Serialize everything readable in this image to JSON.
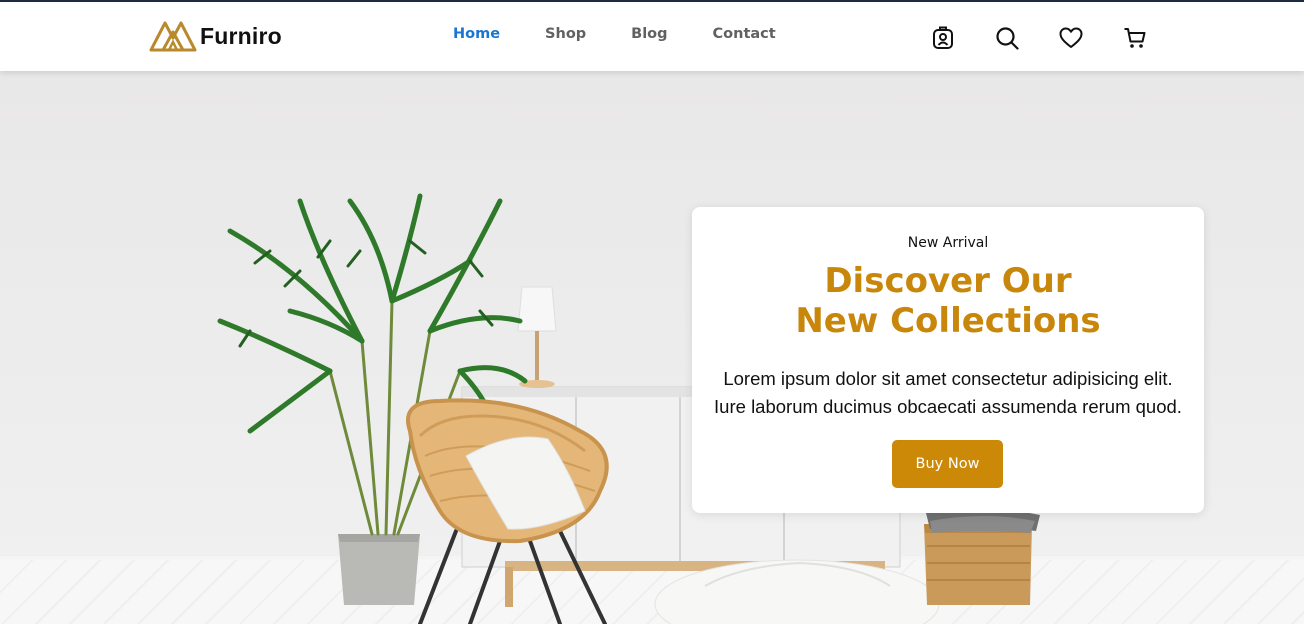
{
  "brand": {
    "name": "Furniro"
  },
  "nav": {
    "items": [
      {
        "label": "Home",
        "active": true
      },
      {
        "label": "Shop",
        "active": false
      },
      {
        "label": "Blog",
        "active": false
      },
      {
        "label": "Contact",
        "active": false
      }
    ]
  },
  "header_icons": [
    "account-icon",
    "search-icon",
    "heart-icon",
    "cart-icon"
  ],
  "hero": {
    "eyebrow": "New Arrival",
    "title_line1": "Discover Our",
    "title_line2": "New Collections",
    "desc_line1": "Lorem ipsum dolor sit amet consectetur adipisicing elit.",
    "desc_line2": "Iure laborum ducimus obcaecati assumenda rerum quod.",
    "button_label": "Buy Now"
  },
  "colors": {
    "accent": "#c8860a",
    "button": "#cc8908",
    "nav_active": "#1976d2",
    "nav_inactive": "#616161"
  }
}
